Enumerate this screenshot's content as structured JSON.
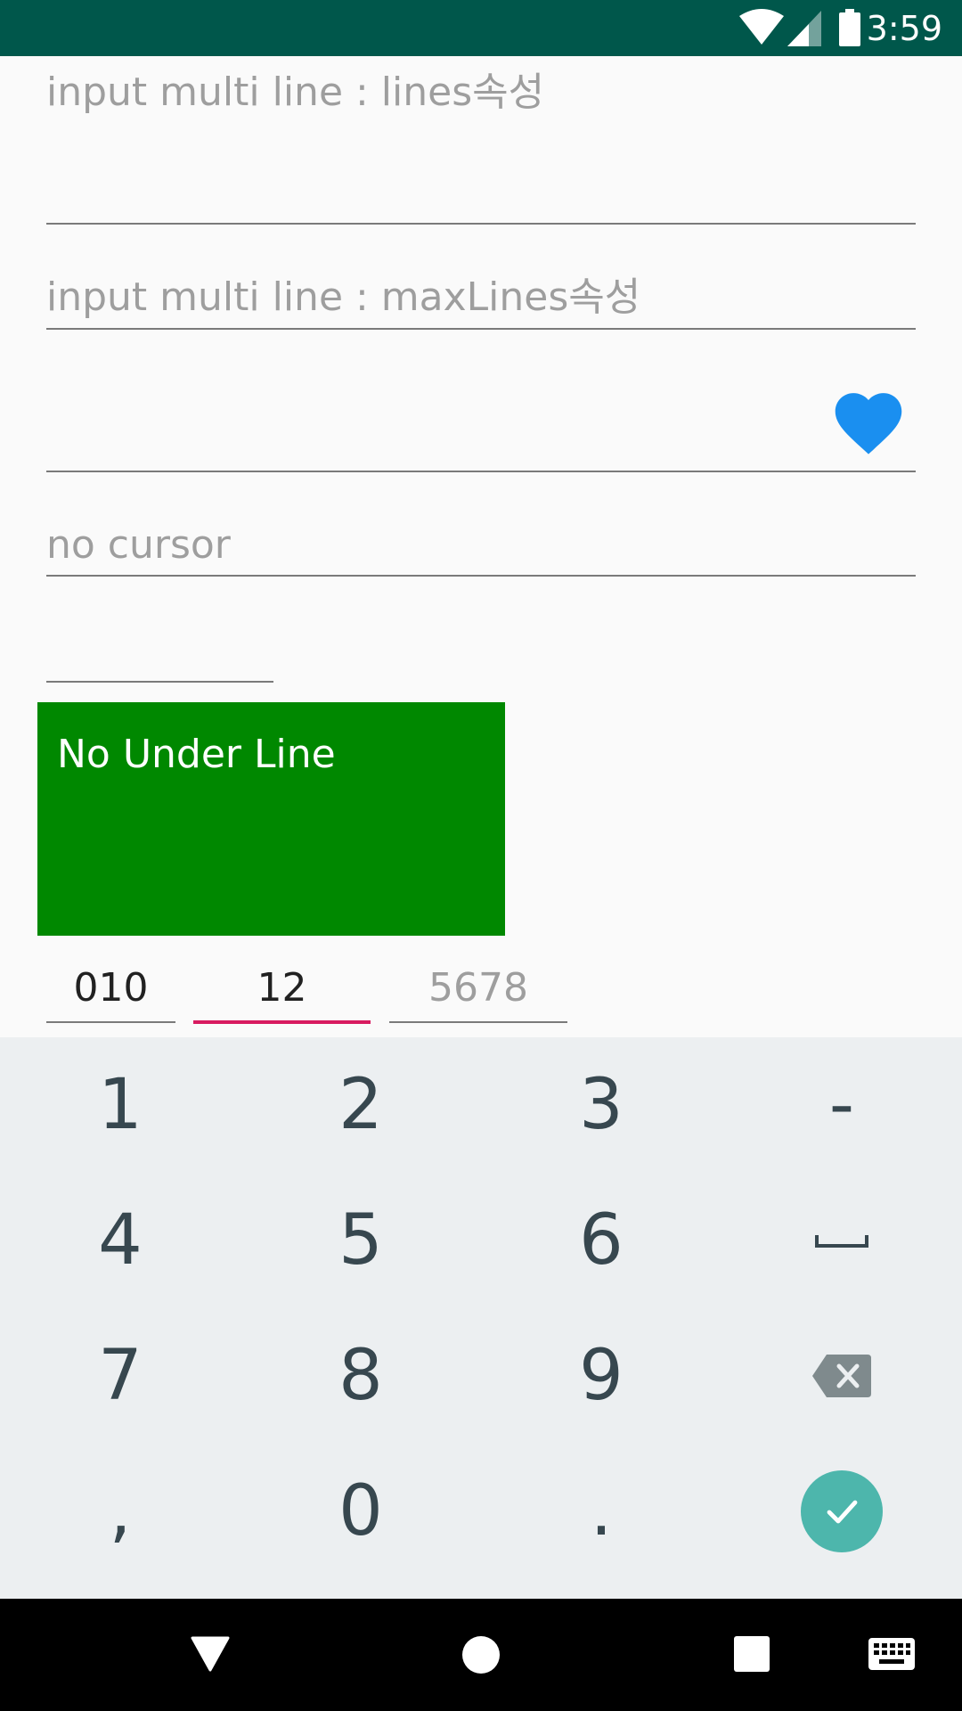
{
  "status_bar": {
    "time": "3:59",
    "icons": [
      "wifi-icon",
      "signal-icon",
      "battery-icon"
    ]
  },
  "fields": {
    "lines_hint": "input multi line : lines속성",
    "maxlines_hint": "input multi line : maxLines속성",
    "icon_field_icon": "heart-icon",
    "no_cursor_hint": "no cursor",
    "no_underline_text": "No Under Line"
  },
  "phone": {
    "part1": "010",
    "part2": "12",
    "part3_hint": "5678"
  },
  "keyboard": {
    "rows": [
      [
        "1",
        "2",
        "3",
        "-"
      ],
      [
        "4",
        "5",
        "6",
        "space"
      ],
      [
        "7",
        "8",
        "9",
        "backspace"
      ],
      [
        ",",
        "0",
        ".",
        "done"
      ]
    ]
  },
  "nav_bar": {
    "icons": [
      "back-icon",
      "home-icon",
      "recents-icon",
      "keyboard-icon"
    ]
  },
  "colors": {
    "status_bar": "#00574b",
    "heart": "#1a8ff0",
    "green_box": "#008800",
    "focus_underline": "#d81b60",
    "keyboard_bg": "#eceff1",
    "done_button": "#4db6ac"
  }
}
